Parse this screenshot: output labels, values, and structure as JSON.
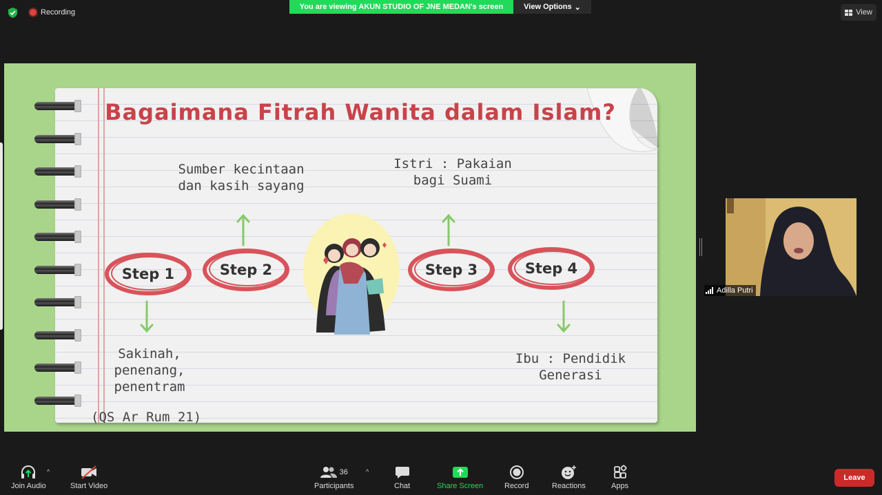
{
  "top_bar": {
    "recording_label": "Recording",
    "viewing_banner": "You are viewing AKUN STUDIO OF JNE MEDAN's screen",
    "view_options_label": "View Options",
    "view_label": "View",
    "banner_color": "#23d959"
  },
  "slide": {
    "title": "Bagaimana Fitrah Wanita dalam Islam?",
    "steps": [
      {
        "label": "Step 1"
      },
      {
        "label": "Step 2"
      },
      {
        "label": "Step 3"
      },
      {
        "label": "Step 4"
      }
    ],
    "notes": {
      "step1": [
        "Sakinah,",
        "penenang,",
        "penentram"
      ],
      "step2": [
        "Sumber kecintaan",
        "dan kasih sayang"
      ],
      "step3": [
        "Istri : Pakaian",
        "bagi Suami"
      ],
      "step4": [
        "Ibu : Pendidik",
        "Generasi"
      ],
      "reference": "(QS Ar Rum 21)"
    },
    "title_color": "#c8434a",
    "step_ring_color": "#d9535b",
    "arrow_color": "#86c96a"
  },
  "participant": {
    "name": "Adilla Putri"
  },
  "toolbar": {
    "join_audio": "Join Audio",
    "start_video": "Start Video",
    "participants": "Participants",
    "participants_count": "36",
    "chat": "Chat",
    "share_screen": "Share Screen",
    "record": "Record",
    "reactions": "Reactions",
    "apps": "Apps",
    "leave": "Leave",
    "share_color": "#23d959",
    "leave_color": "#cb2a2a"
  }
}
